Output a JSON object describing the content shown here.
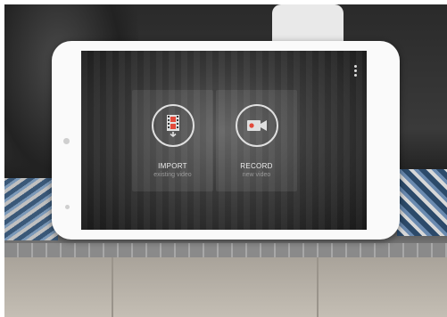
{
  "app": {
    "import": {
      "title": "IMPORT",
      "subtitle": "existing video",
      "icon": "film-import-icon"
    },
    "record": {
      "title": "RECORD",
      "subtitle": "new video",
      "icon": "video-camera-icon"
    },
    "menu_icon": "overflow-menu-icon"
  },
  "colors": {
    "accent": "#e24a3b",
    "icon_stroke": "#e0e0e0",
    "tablet_bezel": "#fafafa"
  }
}
